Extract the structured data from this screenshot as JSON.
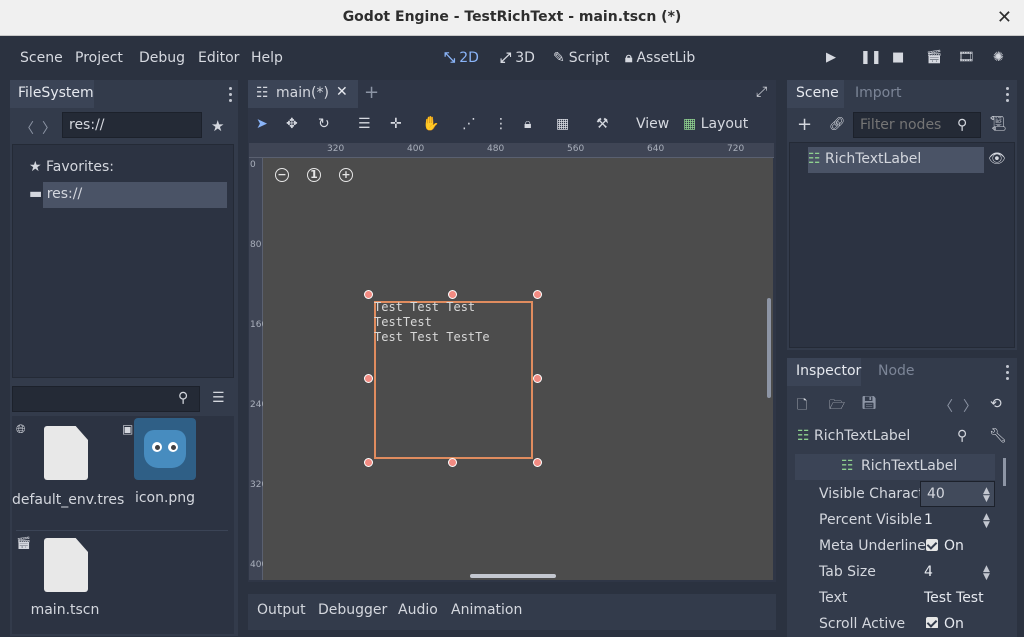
{
  "window": {
    "title": "Godot Engine - TestRichText - main.tscn (*)"
  },
  "menu": {
    "items": [
      "Scene",
      "Project",
      "Debug",
      "Editor",
      "Help"
    ]
  },
  "modes": {
    "twod": "2D",
    "threed": "3D",
    "script": "Script",
    "assetlib": "AssetLib"
  },
  "filesystem": {
    "tab": "FileSystem",
    "path": "res://",
    "favorites": "Favorites:",
    "root": "res://",
    "files": [
      {
        "name": "default_env.tres",
        "icon": "document-icon"
      },
      {
        "name": "icon.png",
        "icon": "godot-icon"
      },
      {
        "name": "main.tscn",
        "icon": "document-icon"
      }
    ]
  },
  "editor": {
    "tab": "main(*)",
    "view_label": "View",
    "layout_label": "Layout",
    "ruler_h": [
      "320",
      "400",
      "480",
      "560",
      "640",
      "720"
    ],
    "ruler_v": [
      "0",
      "80",
      "160",
      "240",
      "320",
      "400"
    ],
    "rich_text_line1": "Test Test Test TestTest",
    "rich_text_line2": "Test Test TestTe"
  },
  "bottom_tabs": [
    "Output",
    "Debugger",
    "Audio",
    "Animation"
  ],
  "scene_dock": {
    "tab_scene": "Scene",
    "tab_import": "Import",
    "filter_placeholder": "Filter nodes",
    "node_name": "RichTextLabel"
  },
  "inspector": {
    "tab_inspector": "Inspector",
    "tab_node": "Node",
    "object_name": "RichTextLabel",
    "section": "RichTextLabel",
    "props": [
      {
        "label": "Visible Charact",
        "value": "40"
      },
      {
        "label": "Percent Visible",
        "value": "1"
      },
      {
        "label": "Meta Underline",
        "value": "On"
      },
      {
        "label": "Tab Size",
        "value": "4"
      },
      {
        "label": "Text",
        "value": "Test Test"
      },
      {
        "label": "Scroll Active",
        "value": "On"
      }
    ]
  },
  "colors": {
    "accent": "#8ab4f8",
    "selection_box": "#e08c5f",
    "handle": "#f28b82"
  }
}
